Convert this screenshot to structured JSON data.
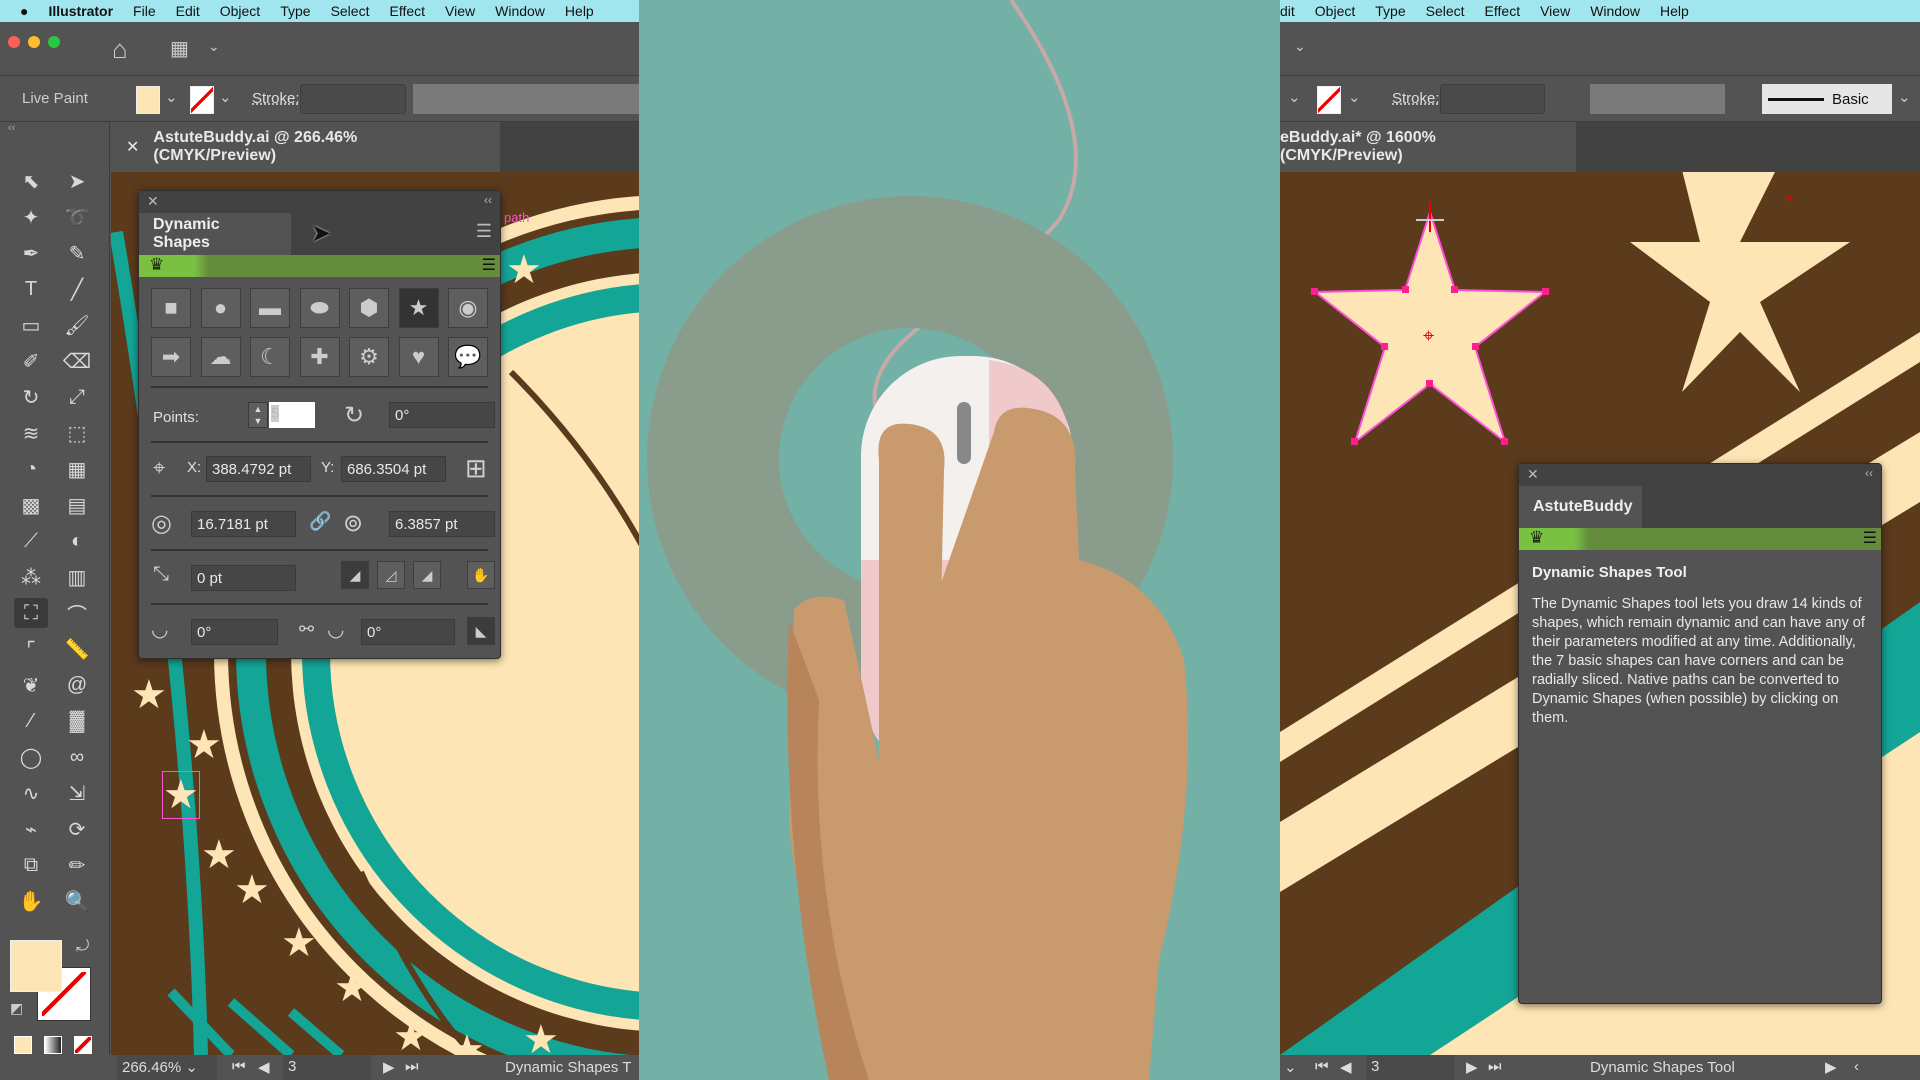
{
  "menubar": {
    "app": "Illustrator",
    "items": [
      "File",
      "Edit",
      "Object",
      "Type",
      "Select",
      "Effect",
      "View",
      "Window",
      "Help"
    ],
    "right_items": [
      "dit",
      "Object",
      "Type",
      "Select",
      "Effect",
      "View",
      "Window",
      "Help"
    ]
  },
  "left": {
    "control": {
      "mode": "Live Paint",
      "stroke_label": "Stroke:"
    },
    "doc_tab": "AstuteBuddy.ai @ 266.46% (CMYK/Preview)",
    "status": {
      "zoom": "266.46%",
      "artboard": "3",
      "tool": "Dynamic Shapes T"
    },
    "canvas_label": "path"
  },
  "dynamic_shapes_panel": {
    "title": "Dynamic Shapes",
    "shapes": [
      {
        "name": "square",
        "glyph": "■"
      },
      {
        "name": "circle",
        "glyph": "●"
      },
      {
        "name": "rectangle",
        "glyph": "▬"
      },
      {
        "name": "ellipse",
        "glyph": "⬬"
      },
      {
        "name": "hexagon",
        "glyph": "⬢"
      },
      {
        "name": "star",
        "glyph": "★",
        "selected": true
      },
      {
        "name": "ring",
        "glyph": "◉"
      },
      {
        "name": "arrow",
        "glyph": "➡"
      },
      {
        "name": "cloud",
        "glyph": "☁"
      },
      {
        "name": "crescent",
        "glyph": "☾"
      },
      {
        "name": "cross",
        "glyph": "✚"
      },
      {
        "name": "gear",
        "glyph": "⚙"
      },
      {
        "name": "heart",
        "glyph": "♥"
      },
      {
        "name": "speech-bubble",
        "glyph": "💬"
      }
    ],
    "points_label": "Points:",
    "points_value": "5",
    "rotation": "0°",
    "x_label": "X:",
    "x_value": "388.4792 pt",
    "y_label": "Y:",
    "y_value": "686.3504 pt",
    "outer_radius": "16.7181 pt",
    "inner_radius": "6.3857 pt",
    "corner_radius": "0 pt",
    "slice_start": "0°",
    "slice_end": "0°"
  },
  "right": {
    "stroke_label": "Stroke:",
    "brush": "Basic",
    "doc_tab": "eBuddy.ai* @ 1600% (CMYK/Preview)",
    "status": {
      "artboard": "3",
      "tool": "Dynamic Shapes Tool"
    }
  },
  "astutebuddy_panel": {
    "title": "AstuteBuddy",
    "heading": "Dynamic Shapes Tool",
    "body": "The Dynamic Shapes tool lets you draw 14 kinds of shapes, which remain dynamic and can have any of their parameters modified at any time. Additionally, the 7 basic shapes can have corners and can be radially sliced. Native paths can be converted to Dynamic Shapes (when possible) by clicking on them."
  },
  "tools": [
    {
      "name": "selection",
      "glyph": "⬉"
    },
    {
      "name": "direct-selection",
      "glyph": "➤"
    },
    {
      "name": "magic-wand",
      "glyph": "✦"
    },
    {
      "name": "lasso",
      "glyph": "➰"
    },
    {
      "name": "pen",
      "glyph": "✒"
    },
    {
      "name": "curvature",
      "glyph": "✎"
    },
    {
      "name": "type",
      "glyph": "T"
    },
    {
      "name": "line",
      "glyph": "╱"
    },
    {
      "name": "rectangle",
      "glyph": "▭"
    },
    {
      "name": "paintbrush",
      "glyph": "🖌"
    },
    {
      "name": "blob-brush",
      "glyph": "✐"
    },
    {
      "name": "eraser",
      "glyph": "⌫"
    },
    {
      "name": "rotate",
      "glyph": "↻"
    },
    {
      "name": "scale",
      "glyph": "⤢"
    },
    {
      "name": "warp",
      "glyph": "≋"
    },
    {
      "name": "free-transform",
      "glyph": "⬚"
    },
    {
      "name": "shape-builder",
      "glyph": "◔"
    },
    {
      "name": "perspective-grid",
      "glyph": "▦"
    },
    {
      "name": "mesh",
      "glyph": "▩"
    },
    {
      "name": "gradient",
      "glyph": "▤"
    },
    {
      "name": "eyedropper",
      "glyph": "⟋"
    },
    {
      "name": "blend",
      "glyph": "◐"
    },
    {
      "name": "symbol-sprayer",
      "glyph": "⁂"
    },
    {
      "name": "column-graph",
      "glyph": "▥"
    },
    {
      "name": "dynamic-shapes",
      "glyph": "⛶",
      "selected": true
    },
    {
      "name": "width",
      "glyph": "⌒"
    },
    {
      "name": "corner",
      "glyph": "⌜"
    },
    {
      "name": "measure",
      "glyph": "📏"
    },
    {
      "name": "butterfly",
      "glyph": "❦"
    },
    {
      "name": "spiral",
      "glyph": "@"
    },
    {
      "name": "brush-tool",
      "glyph": "⁄"
    },
    {
      "name": "texture",
      "glyph": "▓"
    },
    {
      "name": "circle-tool",
      "glyph": "◯"
    },
    {
      "name": "glasses",
      "glyph": "∞"
    },
    {
      "name": "path-tool",
      "glyph": "∿"
    },
    {
      "name": "reform",
      "glyph": "⇲"
    },
    {
      "name": "smart-remove",
      "glyph": "⌁"
    },
    {
      "name": "lasso-plus",
      "glyph": "⟳"
    },
    {
      "name": "artboard",
      "glyph": "⧉"
    },
    {
      "name": "pencil",
      "glyph": "✏"
    },
    {
      "name": "hand",
      "glyph": "✋"
    },
    {
      "name": "zoom",
      "glyph": "🔍"
    }
  ],
  "colors": {
    "menubar": "#a1e6ee",
    "ui": "#535353",
    "brown": "#5c3a1c",
    "cream": "#fde5b5",
    "teal": "#13a596",
    "backdrop": "#73b0a5",
    "skin": "#c99a6e",
    "green": "#7ac142"
  }
}
